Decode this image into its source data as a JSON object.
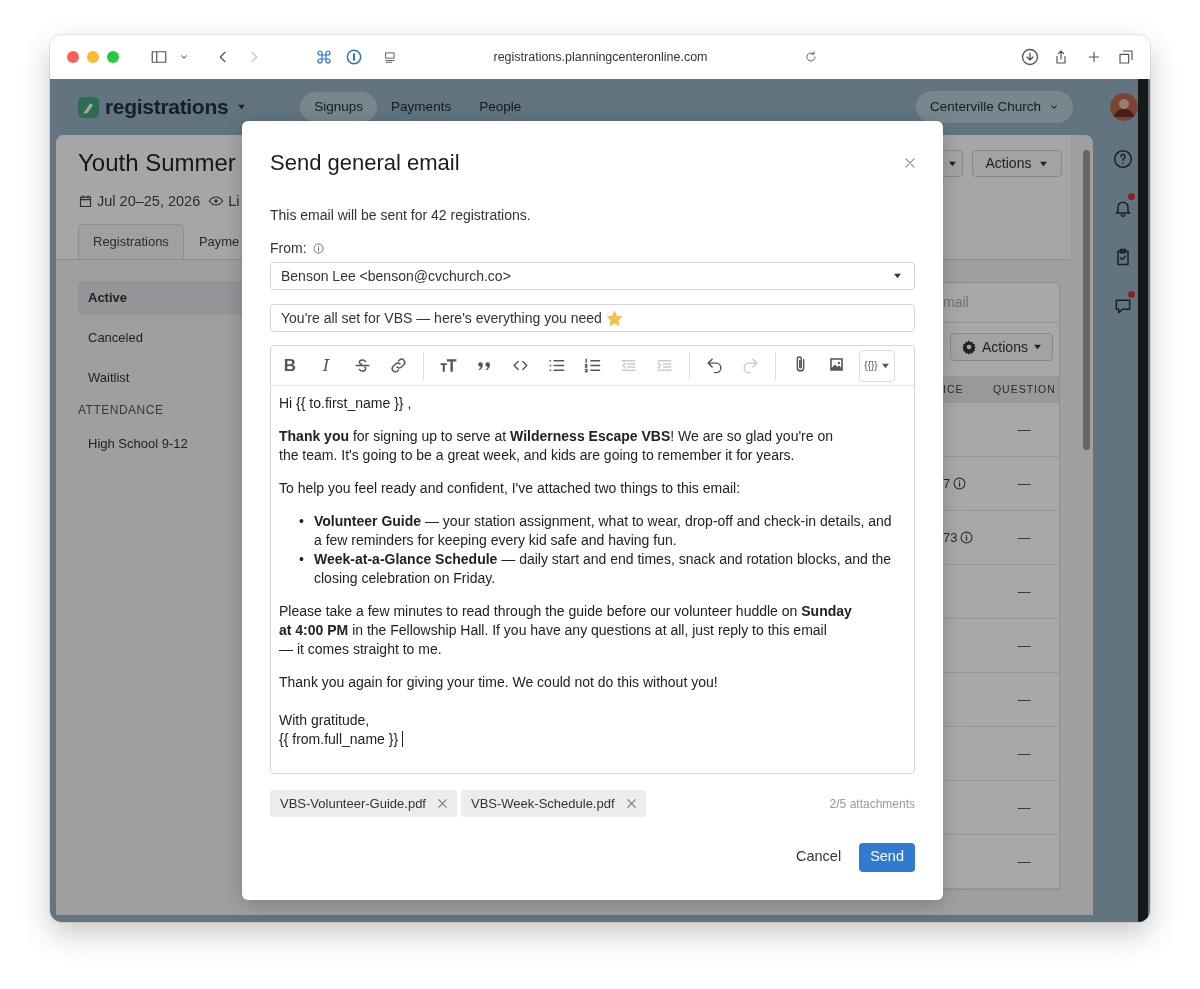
{
  "browser": {
    "url": "registrations.planningcenteronline.com",
    "forward_disabled": true
  },
  "app": {
    "logo": "registrations",
    "nav": [
      {
        "label": "Signups",
        "selected": true
      },
      {
        "label": "Payments",
        "selected": false
      },
      {
        "label": "People",
        "selected": false
      }
    ],
    "org": "Centerville Church",
    "rail": [
      {
        "badge": false
      },
      {
        "badge": true
      },
      {
        "badge": false
      },
      {
        "badge": true
      }
    ]
  },
  "page": {
    "title": "Youth Summer",
    "date": "Jul 20–25, 2026",
    "visibility": "Li",
    "tabs": [
      {
        "label": "Registrations",
        "selected": true
      },
      {
        "label": "Payme",
        "selected": false
      }
    ],
    "sidebar": [
      {
        "label": "Active",
        "selected": true
      },
      {
        "label": "Canceled",
        "selected": false
      },
      {
        "label": "Waitlist",
        "selected": false
      }
    ],
    "attendance": {
      "heading": "ATTENDANCE",
      "items": [
        {
          "label": "High School 9-12",
          "selected": false
        }
      ]
    },
    "header_actions": "Actions",
    "search": {
      "placeholder": "mail"
    },
    "list_actions": "Actions",
    "table": {
      "columns": [
        "ICE",
        "QUESTION"
      ],
      "rows": [
        {
          "column_1": "",
          "info": false,
          "question": "—"
        },
        {
          "column_1": "7",
          "info": true,
          "question": "—"
        },
        {
          "column_1": "73",
          "info": true,
          "question": "—"
        },
        {
          "column_1": "",
          "info": false,
          "question": "—"
        },
        {
          "column_1": "",
          "info": false,
          "question": "—"
        },
        {
          "column_1": "",
          "info": false,
          "question": "—"
        },
        {
          "column_1": "",
          "info": false,
          "question": "—"
        },
        {
          "column_1": "",
          "info": false,
          "question": "—"
        },
        {
          "column_1": "",
          "info": false,
          "question": "—"
        }
      ]
    }
  },
  "modal": {
    "title": "Send general email",
    "intro": "This email will be sent for 42 registrations.",
    "from_label": "From:",
    "from": "Benson Lee <benson@cvchurch.co>",
    "subject": "You're all set for VBS — here's everything you need",
    "toolbar": [
      [
        {
          "label": "B",
          "disabled": false
        },
        {
          "label": "I",
          "disabled": false
        },
        {
          "disabled": false
        },
        {
          "disabled": false
        }
      ],
      [
        {
          "disabled": false
        },
        {
          "disabled": false
        },
        {
          "disabled": false
        },
        {
          "disabled": false
        },
        {
          "disabled": false
        },
        {
          "disabled": true
        },
        {
          "disabled": true
        }
      ],
      [
        {
          "disabled": false
        },
        {
          "disabled": true
        }
      ],
      [
        {
          "disabled": false
        },
        {
          "disabled": false
        },
        {
          "label": "{{}}",
          "disabled": false
        }
      ]
    ],
    "body": [
      {
        "kind": "paragraph",
        "lines": [
          "Hi {{ to.first_name }} ,"
        ]
      },
      {
        "kind": "paragraph",
        "lines": [
          "**Thank you** for signing up to serve at **Wilderness Escape VBS**! We are so glad you're on",
          "the team. It's going to be a great week, and kids are going to remember it for years."
        ]
      },
      {
        "kind": "paragraph",
        "lines": [
          "To help you feel ready and confident, I've attached two things to this email:"
        ]
      },
      {
        "kind": "bullets",
        "items": [
          {
            "marker": "•",
            "text": "**Volunteer Guide** — your station assignment, what to wear, drop-off and check-in details, and a few reminders for keeping every kid safe and having fun."
          },
          {
            "marker": "•",
            "text": "**Week-at-a-Glance Schedule** — daily start and end times, snack and rotation blocks, and the closing celebration on Friday."
          }
        ]
      },
      {
        "kind": "paragraph",
        "lines": [
          "Please take a few minutes to read through the guide before our volunteer huddle on **Sunday**",
          "**at 4:00 PM** in the Fellowship Hall. If you have any questions at all, just reply to this email",
          "— it comes straight to me."
        ]
      },
      {
        "kind": "paragraph",
        "lines": [
          "Thank you again for giving your time. We could not do this without you!"
        ]
      },
      {
        "kind": "signature",
        "lines": [
          "With gratitude,",
          "{{ from.full_name }}"
        ],
        "cursor": true
      }
    ],
    "attachments": [
      "VBS-Volunteer-Guide.pdf",
      "VBS-Week-Schedule.pdf"
    ],
    "attachment_count": "2/5 attachments",
    "cancel": "Cancel",
    "send": "Send"
  }
}
